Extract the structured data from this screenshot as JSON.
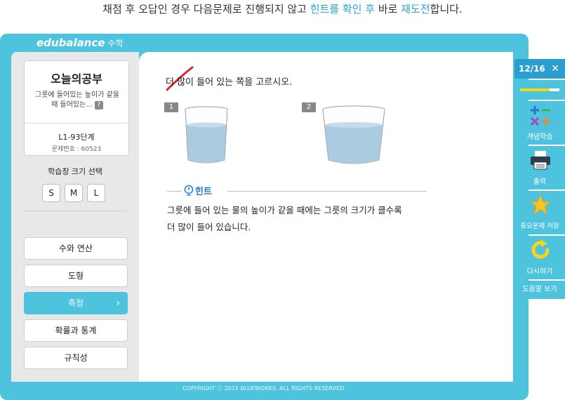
{
  "caption": {
    "part1": "채점 후 오답인 경우 다음문제로 진행되지 않고 ",
    "highlight1": "힌트를 확인 후",
    "part2": " 바로 ",
    "highlight2": "재도전",
    "part3": "합니다."
  },
  "app": {
    "logo": "edubalance",
    "logo_sub": "수학"
  },
  "card": {
    "title": "오늘의공부",
    "desc": "그릇에 들어있는 높이가 같을 때 들어있는...",
    "help": "?",
    "level": "L1-93단계",
    "problem_no": "문제번호 : 60523"
  },
  "size": {
    "label": "학습창 크기 선택",
    "options": [
      "S",
      "M",
      "L"
    ]
  },
  "nav": {
    "items": [
      "수와 연산",
      "도형",
      "측정",
      "확률과 통계",
      "규칙성"
    ],
    "active_index": 2
  },
  "question": {
    "text": "더 많이 들어 있는 쪽을 고르시오.",
    "options": [
      "1",
      "2"
    ],
    "hint_label": "힌트",
    "hint_text_line1": "그릇에 들어 있는 물의 높이가 같을 때에는 그릇의 크기가 클수록",
    "hint_text_line2": "더 많이 들어 있습니다."
  },
  "toolbar": {
    "counter": "12/16",
    "progress_fraction": 0.75,
    "concept_label": "개념학습",
    "print_label": "출력",
    "save_label": "중요문제 저장",
    "retry_label": "다시하기",
    "help_label": "도움말 보기"
  },
  "footer": "COPYRIGHT ⓒ 2015 BLUEWORKS. ALL RIGHTS RESERVED.",
  "colors": {
    "accent": "#4ec3dd",
    "accent_dark": "#2a9fcf",
    "highlight": "#2aa3d6",
    "star": "#f7c51b",
    "water": "#aacbe0",
    "mark": "#d9262c"
  }
}
